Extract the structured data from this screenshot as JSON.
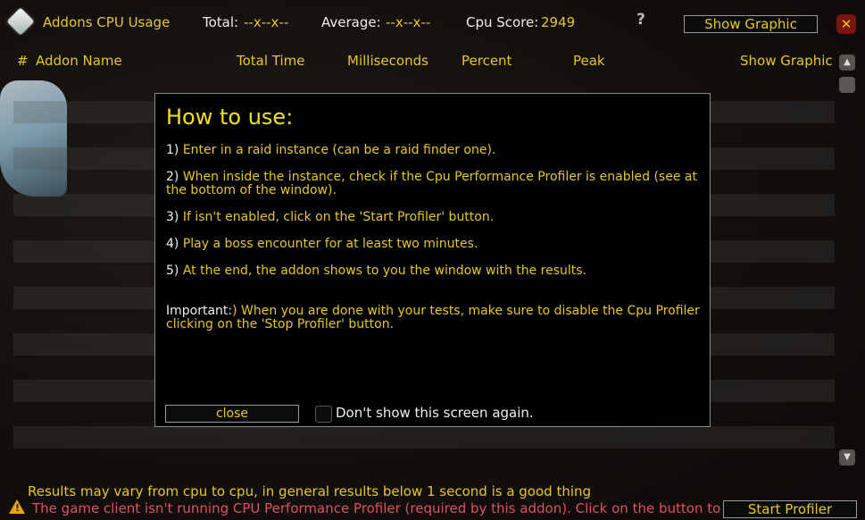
{
  "header": {
    "title": "Addons CPU Usage",
    "total_label": "Total:",
    "total_value": "--x--x--",
    "average_label": "Average:",
    "average_value": "--x--x--",
    "cpu_score_label": "Cpu Score:",
    "cpu_score_value": "2949",
    "help_icon": "?",
    "show_graphic_button": "Show Graphic",
    "close_icon": "✕"
  },
  "table": {
    "columns": [
      "#",
      "Addon Name",
      "Total Time",
      "Milliseconds",
      "Percent",
      "Peak"
    ],
    "show_graphic_label": "Show Graphic",
    "rows": []
  },
  "dialog": {
    "title": "How to use:",
    "steps": [
      {
        "num": "1)",
        "text": " Enter in a raid instance (can be a raid finder one)."
      },
      {
        "num": "2)",
        "text": " When inside the instance, check if the Cpu Performance Profiler is enabled (see at the bottom of the window)."
      },
      {
        "num": "3)",
        "text": " If isn't enabled, click on the 'Start Profiler' button."
      },
      {
        "num": "4)",
        "text": " Play a boss encounter for at least two minutes."
      },
      {
        "num": "5)",
        "text": " At the end, the addon shows to you the window with the results."
      },
      {
        "num": "Important:",
        "text": ") When you are done with your tests, make sure to disable the Cpu Profiler clicking on the 'Stop Profiler' button."
      }
    ],
    "close_button": "close",
    "checkbox_label": "Don't show this screen again.",
    "checkbox_checked": false
  },
  "footer": {
    "note": "Results may vary from cpu to cpu, in general results below 1 second is a good thing",
    "warning": "The game client isn't running CPU Performance Profiler (required by this addon). Click on the button to activate it.",
    "start_profiler_button": "Start Profiler"
  },
  "colors": {
    "gold": "#e6c62a",
    "warning_red": "#e05060",
    "dialog_title": "#f0e020"
  }
}
